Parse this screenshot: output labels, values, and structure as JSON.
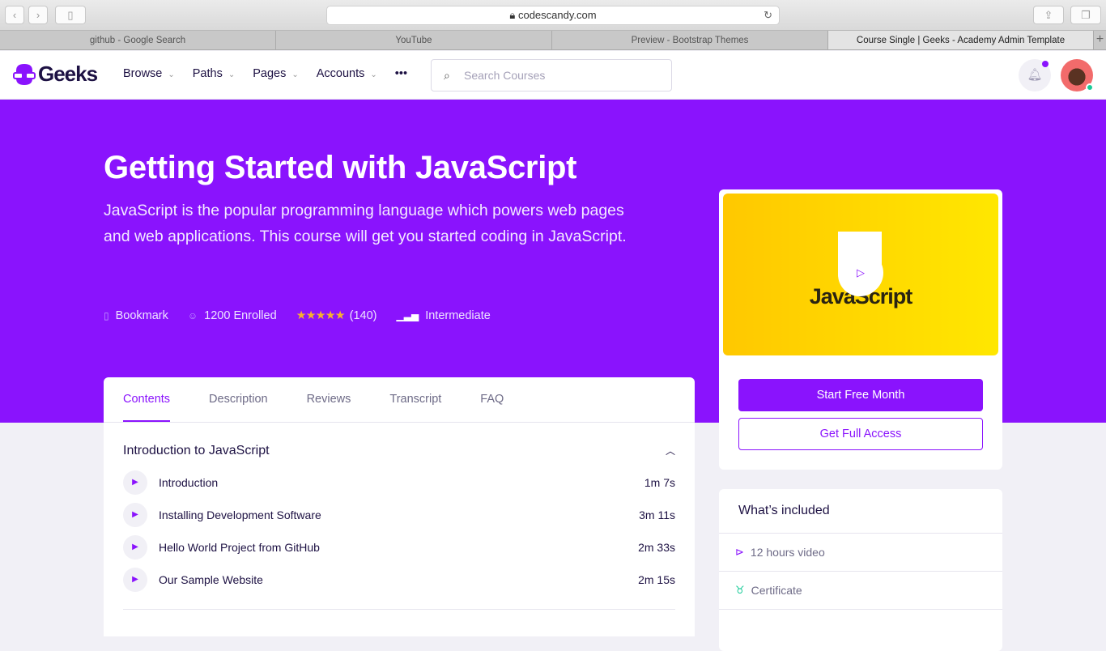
{
  "browser": {
    "url": "codescandy.com",
    "tabs": [
      "github - Google Search",
      "YouTube",
      "Preview - Bootstrap Themes",
      "Course Single | Geeks - Academy Admin Template"
    ],
    "active_tab": 3
  },
  "nav": {
    "logo": "Geeks",
    "menu": [
      "Browse",
      "Paths",
      "Pages",
      "Accounts"
    ],
    "more": "•••",
    "search_placeholder": "Search Courses"
  },
  "hero": {
    "title": "Getting Started with JavaScript",
    "description": "JavaScript is the popular programming language which powers web pages and web applications. This course will get you started coding in JavaScript.",
    "bookmark": "Bookmark",
    "enrolled": "1200 Enrolled",
    "rating": 5,
    "stars": "★★★★★",
    "rating_count": "(140)",
    "level": "Intermediate"
  },
  "tabs": [
    "Contents",
    "Description",
    "Reviews",
    "Transcript",
    "FAQ"
  ],
  "section": {
    "title": "Introduction to JavaScript",
    "lessons": [
      {
        "title": "Introduction",
        "duration": "1m 7s"
      },
      {
        "title": "Installing Development Software",
        "duration": "3m 11s"
      },
      {
        "title": "Hello World Project from GitHub",
        "duration": "2m 33s"
      },
      {
        "title": "Our Sample Website",
        "duration": "2m 15s"
      }
    ]
  },
  "sidebar": {
    "thumb_text": "JavaScript",
    "start_label": "Start Free Month",
    "full_label": "Get Full Access"
  },
  "included": {
    "title": "What’s included",
    "items": [
      "12 hours video",
      "Certificate"
    ]
  },
  "colors": {
    "primary": "#8a13fd",
    "online": "#19cb98",
    "star": "#f7b030"
  }
}
